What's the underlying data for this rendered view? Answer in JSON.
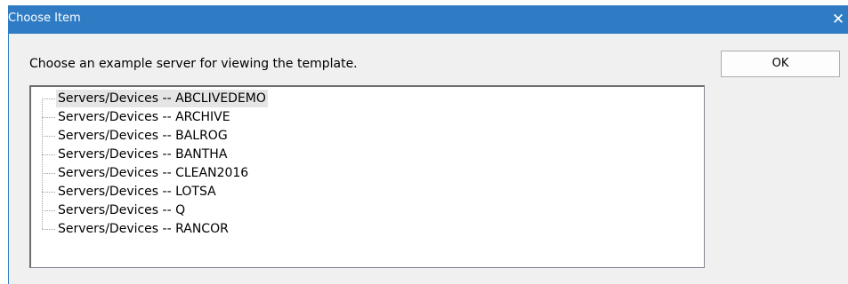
{
  "window": {
    "title": "Choose Item",
    "close_glyph": "✕",
    "accent_color": "#2f7cc4"
  },
  "dialog": {
    "prompt": "Choose an example server for viewing the template.",
    "ok_label": "OK"
  },
  "tree": {
    "selected_index": 0,
    "items": [
      {
        "label": "Servers/Devices -- ABCLIVEDEMO"
      },
      {
        "label": "Servers/Devices -- ARCHIVE"
      },
      {
        "label": "Servers/Devices -- BALROG"
      },
      {
        "label": "Servers/Devices -- BANTHA"
      },
      {
        "label": "Servers/Devices -- CLEAN2016"
      },
      {
        "label": "Servers/Devices -- LOTSA"
      },
      {
        "label": "Servers/Devices -- Q"
      },
      {
        "label": "Servers/Devices -- RANCOR"
      }
    ]
  }
}
